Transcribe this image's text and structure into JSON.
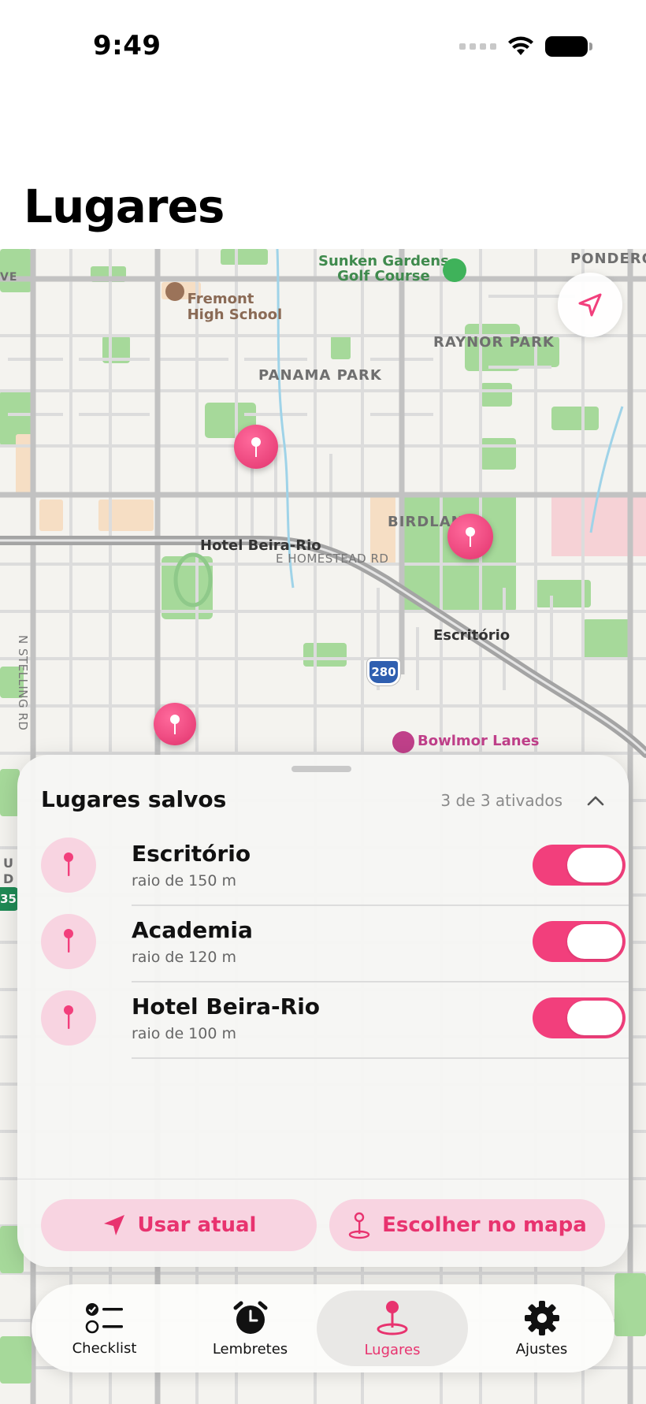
{
  "status_bar": {
    "time": "9:49"
  },
  "page": {
    "title": "Lugares"
  },
  "map": {
    "labels": {
      "fremont": "Fremont\nHigh School",
      "sunken": "Sunken Gardens\nGolf Course",
      "ponderosa": "PONDEROS",
      "raynor": "RAYNOR PARK",
      "panama": "PANAMA PARK",
      "birdland": "BIRDLAND",
      "homestead": "E HOMESTEAD RD",
      "stelling": "N STELLING RD",
      "bowlmor": "Bowlmor Lanes",
      "highway": "280",
      "edge_ve": "VE",
      "edge_u": "U",
      "edge_d": "D",
      "edge_35": "35"
    },
    "pins": [
      {
        "label": "Hotel Beira-Rio"
      },
      {
        "label": "Escritório"
      },
      {
        "label": ""
      }
    ]
  },
  "sheet": {
    "title": "Lugares salvos",
    "count": "3 de 3 ativados",
    "places": [
      {
        "name": "Escritório",
        "radius": "raio de 150 m",
        "enabled": true
      },
      {
        "name": "Academia",
        "radius": "raio de 120 m",
        "enabled": true
      },
      {
        "name": "Hotel Beira-Rio",
        "radius": "raio de 100 m",
        "enabled": true
      }
    ],
    "use_current_label": "Usar atual",
    "choose_on_map_label": "Escolher no mapa"
  },
  "tabbar": {
    "tabs": [
      {
        "label": "Checklist",
        "icon": "checklist-icon"
      },
      {
        "label": "Lembretes",
        "icon": "alarm-clock-icon"
      },
      {
        "label": "Lugares",
        "icon": "location-pin-icon",
        "active": true
      },
      {
        "label": "Ajustes",
        "icon": "gear-icon"
      }
    ]
  },
  "colors": {
    "accent": "#F23F7C",
    "accent_soft": "#F8D4E1",
    "park": "#A6D99A",
    "road": "#D9D9D9",
    "highway": "#9A9A9A"
  }
}
